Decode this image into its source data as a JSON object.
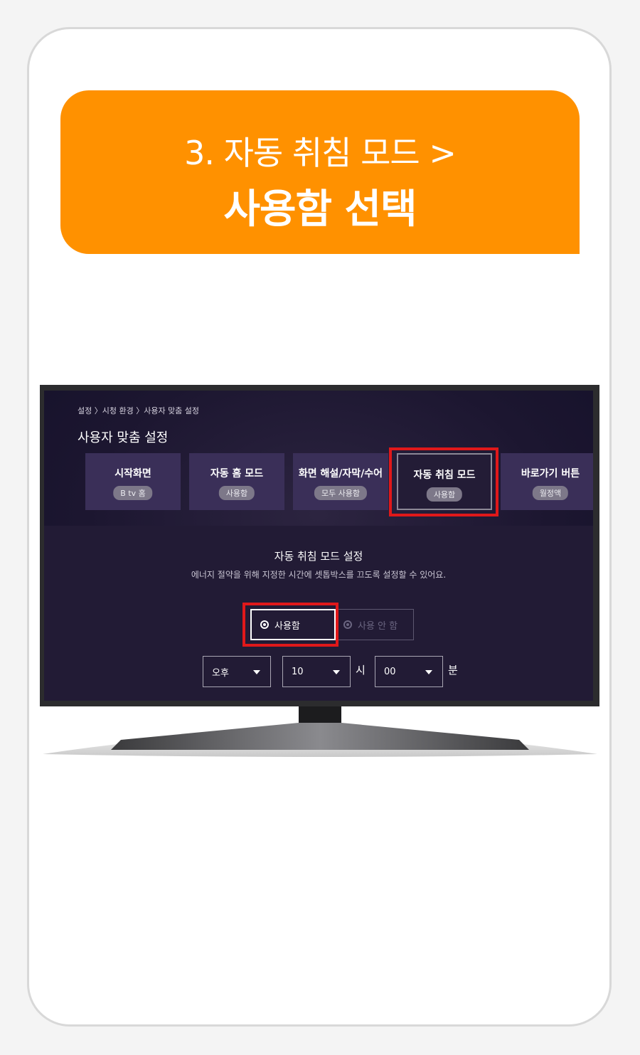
{
  "banner": {
    "line1": "3. 자동 취침 모드 >",
    "line2": "사용함 선택"
  },
  "tv": {
    "breadcrumb": "설정 〉시청 환경 〉사용자 맞춤 설정",
    "page_title": "사용자 맞춤 설정",
    "menu": [
      {
        "label": "시작화면",
        "value": "B tv 홈"
      },
      {
        "label": "자동 홈 모드",
        "value": "사용함"
      },
      {
        "label": "화면 해설/자막/수어",
        "value": "모두 사용함"
      },
      {
        "label": "자동 취침 모드",
        "value": "사용함",
        "selected": true
      },
      {
        "label": "바로가기 버튼",
        "value": "월정액"
      }
    ],
    "section_title": "자동 취침 모드 설정",
    "section_desc": "에너지 절약을 위해 지정한 시간에 셋톱박스를 끄도록 설정할 수 있어요.",
    "radio_on": "사용함",
    "radio_off": "사용 안 함",
    "ampm": "오후",
    "hour": "10",
    "hour_unit": "시",
    "minute": "00",
    "minute_unit": "분",
    "highlight_color": "#e0181a"
  },
  "colors": {
    "banner": "#ff9100",
    "screen_bg": "#1c1630",
    "menu_bg": "#3a2f58"
  }
}
